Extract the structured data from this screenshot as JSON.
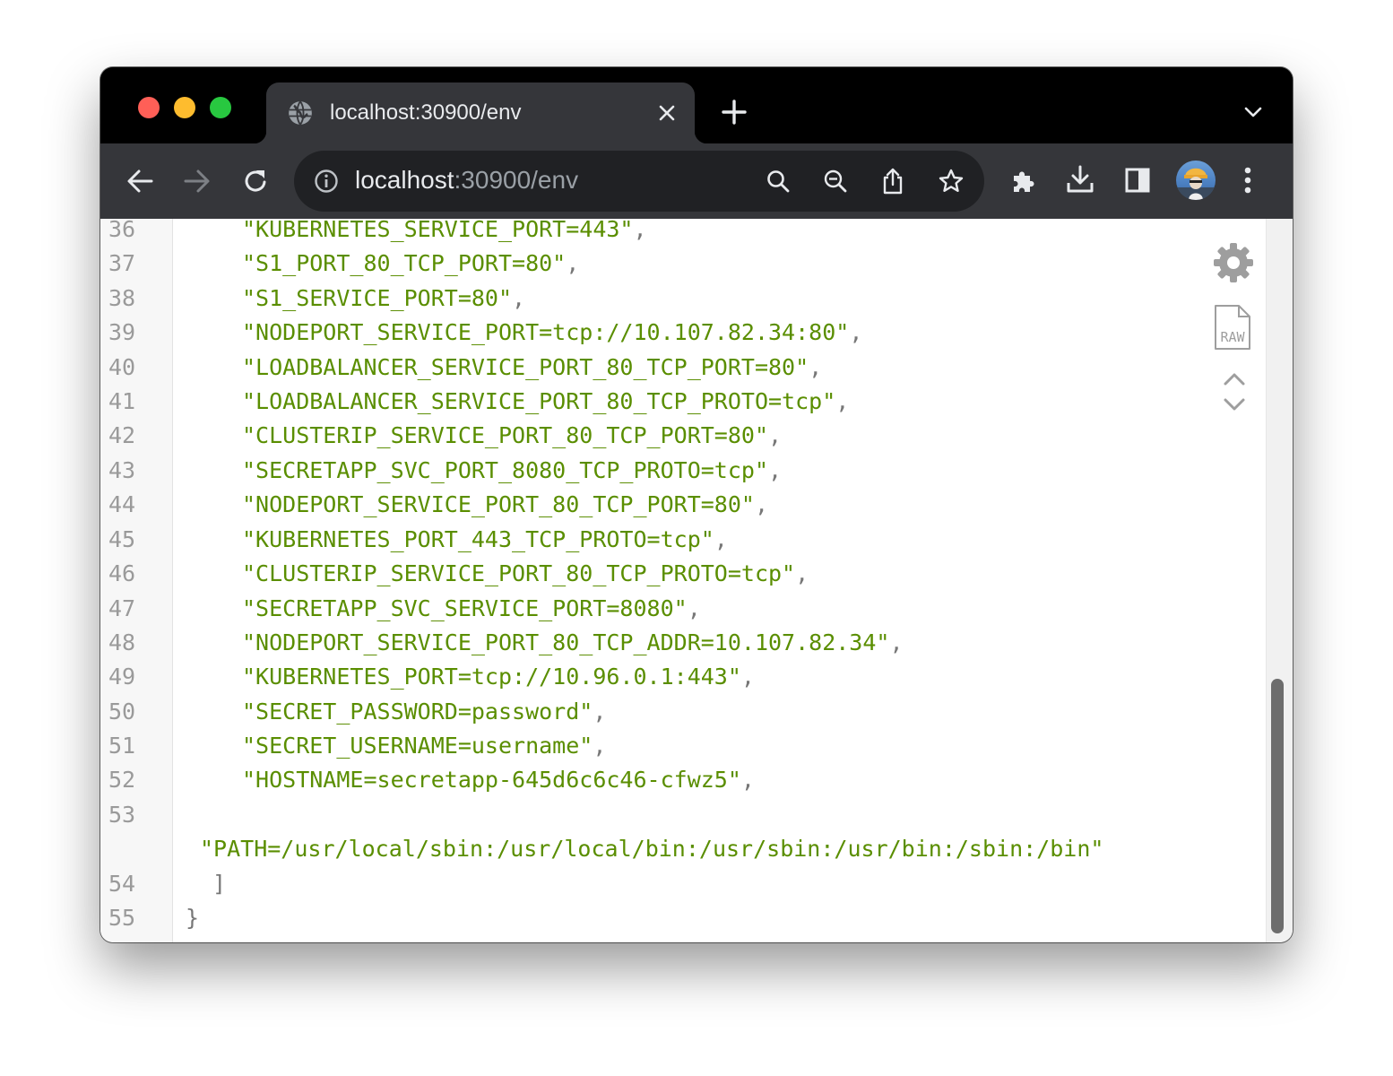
{
  "tab": {
    "title": "localhost:30900/env",
    "icon": "globe-icon"
  },
  "omnibox": {
    "host": "localhost",
    "rest": ":30900/env"
  },
  "toolbar_icons": [
    "back-arrow-icon",
    "forward-arrow-icon",
    "reload-icon",
    "info-icon",
    "search-icon",
    "zoom-out-icon",
    "share-icon",
    "star-icon",
    "extensions-puzzle-icon",
    "download-icon",
    "side-panel-icon",
    "avatar",
    "more-vert-icon"
  ],
  "viewer_tools": [
    "gear-icon",
    "raw-icon",
    "chevron-up-icon",
    "chevron-down-icon"
  ],
  "colors": {
    "string": "#5a8e00",
    "line_number": "#9a9a9a",
    "tab_strip": "#000000",
    "toolbar": "#35363a"
  },
  "code": {
    "lines": [
      {
        "n": "36",
        "text": "\"KUBERNETES_SERVICE_PORT=443\"",
        "trail": ","
      },
      {
        "n": "37",
        "text": "\"S1_PORT_80_TCP_PORT=80\"",
        "trail": ","
      },
      {
        "n": "38",
        "text": "\"S1_SERVICE_PORT=80\"",
        "trail": ","
      },
      {
        "n": "39",
        "text": "\"NODEPORT_SERVICE_PORT=tcp://10.107.82.34:80\"",
        "trail": ","
      },
      {
        "n": "40",
        "text": "\"LOADBALANCER_SERVICE_PORT_80_TCP_PORT=80\"",
        "trail": ","
      },
      {
        "n": "41",
        "text": "\"LOADBALANCER_SERVICE_PORT_80_TCP_PROTO=tcp\"",
        "trail": ","
      },
      {
        "n": "42",
        "text": "\"CLUSTERIP_SERVICE_PORT_80_TCP_PORT=80\"",
        "trail": ","
      },
      {
        "n": "43",
        "text": "\"SECRETAPP_SVC_PORT_8080_TCP_PROTO=tcp\"",
        "trail": ","
      },
      {
        "n": "44",
        "text": "\"NODEPORT_SERVICE_PORT_80_TCP_PORT=80\"",
        "trail": ","
      },
      {
        "n": "45",
        "text": "\"KUBERNETES_PORT_443_TCP_PROTO=tcp\"",
        "trail": ","
      },
      {
        "n": "46",
        "text": "\"CLUSTERIP_SERVICE_PORT_80_TCP_PROTO=tcp\"",
        "trail": ","
      },
      {
        "n": "47",
        "text": "\"SECRETAPP_SVC_SERVICE_PORT=8080\"",
        "trail": ","
      },
      {
        "n": "48",
        "text": "\"NODEPORT_SERVICE_PORT_80_TCP_ADDR=10.107.82.34\"",
        "trail": ","
      },
      {
        "n": "49",
        "text": "\"KUBERNETES_PORT=tcp://10.96.0.1:443\"",
        "trail": ","
      },
      {
        "n": "50",
        "text": "\"SECRET_PASSWORD=password\"",
        "trail": ","
      },
      {
        "n": "51",
        "text": "\"SECRET_USERNAME=username\"",
        "trail": ","
      },
      {
        "n": "52",
        "text": "\"HOSTNAME=secretapp-645d6c6c46-cfwz5\"",
        "trail": ","
      },
      {
        "n": "53",
        "text": "",
        "trail": ""
      },
      {
        "n": "",
        "text": "\"PATH=/usr/local/sbin:/usr/local/bin:/usr/sbin:/usr/bin:/sbin:/bin\"",
        "trail": ""
      },
      {
        "n": "54",
        "text": "",
        "trail": "]"
      },
      {
        "n": "55",
        "text": "",
        "trail": "}"
      }
    ]
  }
}
